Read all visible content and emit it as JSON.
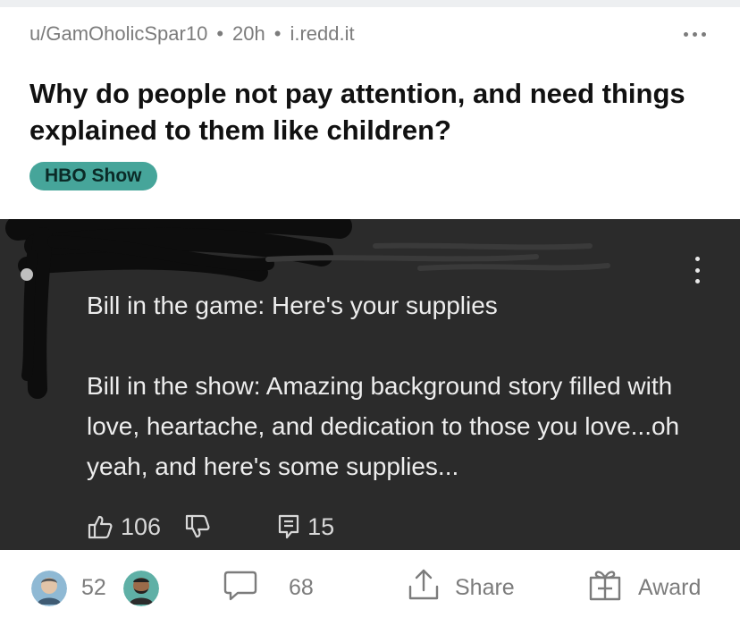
{
  "post": {
    "author": "u/GamOholicSpar10",
    "age": "20h",
    "domain": "i.redd.it",
    "title": "Why do people not pay attention, and need things explained to them like children?",
    "flair": {
      "label": "HBO Show",
      "color": "#46a59a"
    }
  },
  "image": {
    "comment_text": "Bill in the game:  Here's your supplies\n\nBill in the show: Amazing background story filled with love, heartache, and dedication to those you love...oh yeah, and here's some supplies...",
    "likes": "106",
    "replies": "15"
  },
  "actions": {
    "vote_count": "52",
    "comment_count": "68",
    "share_label": "Share",
    "award_label": "Award"
  },
  "icons": [
    "more-options-icon",
    "kebab-icon",
    "thumbs-up-icon",
    "thumbs-down-icon",
    "reply-icon",
    "upvote-avatar-icon",
    "downvote-avatar-icon",
    "comment-icon",
    "share-icon",
    "award-icon"
  ],
  "colors": {
    "accent": "#46a59a",
    "image_bg": "#2b2b2b",
    "meta": "#7c7c7c"
  }
}
